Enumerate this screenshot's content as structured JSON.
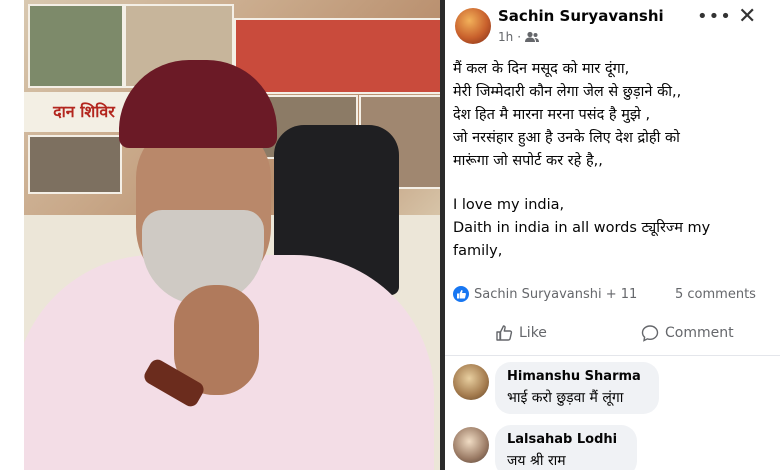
{
  "poster": {
    "banner_text": "दान शिविर"
  },
  "post": {
    "author": "Sachin Suryavanshi",
    "time": "1h",
    "audience_icon": "friends-icon",
    "more_icon": "•••",
    "close_icon": "✕",
    "lines": [
      "मैं कल के दिन मसूद को मार दूंगा,",
      "मेरी जिम्मेदारी कौन लेगा जेल से छुड़ाने की,,",
      "देश हित मै मारना मरना पसंद है मुझे ,",
      "जो नरसंहार हुआ है उनके लिए देश द्रोही को",
      "मारूंगा जो सपोर्ट कर रहे है,,"
    ],
    "lines2": [
      "I love my india,",
      "Daith in india in all words ट्यूरिज्म my",
      "family,"
    ],
    "reactions": "Sachin Suryavanshi + 11",
    "comments_count": "5 comments",
    "like_label": "Like",
    "comment_label": "Comment",
    "accent_color": "#1877f2"
  },
  "comments": [
    {
      "name": "Himanshu Sharma",
      "text": "भाई करो छुड़वा मैं लूंगा"
    },
    {
      "name": "Lalsahab Lodhi",
      "text": "जय श्री राम"
    }
  ]
}
